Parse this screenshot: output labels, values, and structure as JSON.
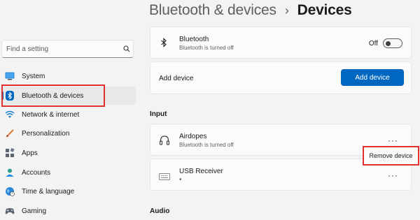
{
  "header": {
    "parent": "Bluetooth & devices",
    "separator": "›",
    "current": "Devices"
  },
  "search": {
    "placeholder": "Find a setting"
  },
  "sidebar": {
    "items": [
      {
        "label": "System",
        "icon": "system-icon"
      },
      {
        "label": "Bluetooth & devices",
        "icon": "bluetooth-icon",
        "active": true
      },
      {
        "label": "Network & internet",
        "icon": "wifi-icon"
      },
      {
        "label": "Personalization",
        "icon": "brush-icon"
      },
      {
        "label": "Apps",
        "icon": "apps-icon"
      },
      {
        "label": "Accounts",
        "icon": "person-icon"
      },
      {
        "label": "Time & language",
        "icon": "globe-icon"
      },
      {
        "label": "Gaming",
        "icon": "gaming-icon"
      }
    ]
  },
  "bluetooth": {
    "title": "Bluetooth",
    "status": "Bluetooth is turned off",
    "toggle_label": "Off",
    "toggle_on": false
  },
  "add_device": {
    "label": "Add device",
    "button": "Add device"
  },
  "sections": {
    "input": "Input",
    "audio": "Audio"
  },
  "devices": [
    {
      "name": "Airdopes",
      "status": "Bluetooth is turned off",
      "icon": "headphones-icon"
    },
    {
      "name": "USB Receiver",
      "status": "•",
      "icon": "keyboard-icon"
    }
  ],
  "more_label": "···",
  "context_menu": {
    "remove": "Remove device"
  },
  "colors": {
    "accent": "#0067c0",
    "highlight": "#e0312d"
  }
}
